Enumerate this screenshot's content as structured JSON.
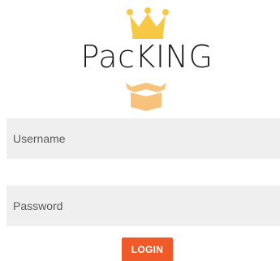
{
  "app": {
    "title": "PacKING"
  },
  "logo": {
    "top_icon": "crown-icon",
    "bottom_icon": "package-box-icon",
    "crown_color": "#f6c843",
    "box_color": "#f7c27c"
  },
  "form": {
    "username": {
      "placeholder": "Username",
      "value": ""
    },
    "password": {
      "placeholder": "Password",
      "value": ""
    },
    "login_label": "LOGIN",
    "login_color": "#f05a28"
  }
}
